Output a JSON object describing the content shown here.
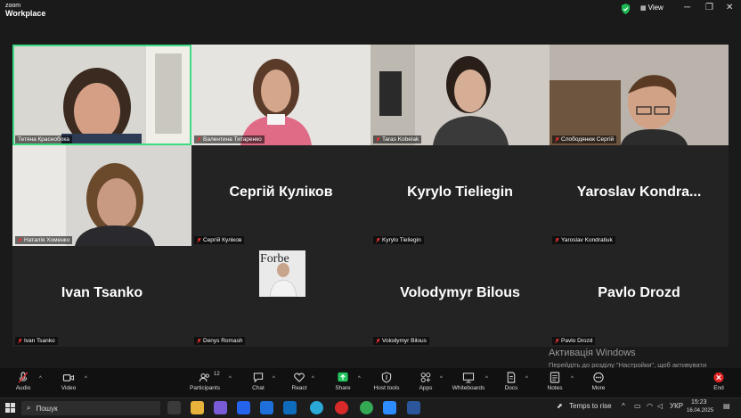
{
  "app": {
    "logo_line1": "zoom",
    "logo_line2": "Workplace",
    "view_label": "View"
  },
  "tiles": [
    {
      "name_tag": "Тетяна Краснобока",
      "big": ""
    },
    {
      "name_tag": "Валентина Титаренко",
      "big": ""
    },
    {
      "name_tag": "Taras Kobelak",
      "big": ""
    },
    {
      "name_tag": "Слободянюк Сергій",
      "big": ""
    },
    {
      "name_tag": "Наталія Хоменко",
      "big": ""
    },
    {
      "name_tag": "Сергій Куліков",
      "big": "Сергій Куліков"
    },
    {
      "name_tag": "Kyrylo Tieliegin",
      "big": "Kyrylo Tieliegin"
    },
    {
      "name_tag": "Yaroslav Kondratiuk",
      "big": "Yaroslav  Kondra..."
    },
    {
      "name_tag": "Ivan Tsanko",
      "big": "Ivan Tsanko"
    },
    {
      "name_tag": "Denys Romash",
      "big": ""
    },
    {
      "name_tag": "Volodymyr Bilous",
      "big": "Volodymyr Bilous"
    },
    {
      "name_tag": "Pavlo Drozd",
      "big": "Pavlo Drozd"
    }
  ],
  "avatar_text": "Forbe",
  "toolbar": {
    "audio": "Audio",
    "video": "Video",
    "participants": "Participants",
    "participants_count": "12",
    "chat": "Chat",
    "react": "React",
    "share": "Share",
    "host_tools": "Host tools",
    "apps": "Apps",
    "whiteboards": "Whiteboards",
    "docs": "Docs",
    "notes": "Notes",
    "more": "More",
    "end": "End"
  },
  "activation": {
    "title": "Активація Windows",
    "line": "Перейдіть до розділу \"Настройки\", щоб активувати Windows."
  },
  "taskbar": {
    "search_placeholder": "Пошук",
    "weather": "Temps to rise",
    "lang": "УКР",
    "time": "15:23",
    "date": "16.04.2025"
  },
  "colors": {
    "active_speaker": "#3ddc84",
    "share": "#22c55e",
    "end": "#e02424"
  }
}
